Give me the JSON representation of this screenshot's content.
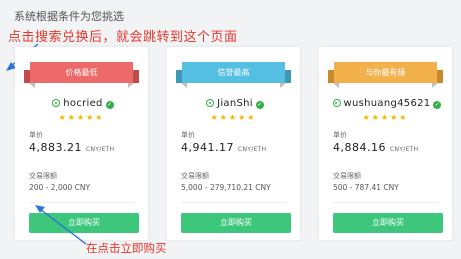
{
  "page_title": "系统根据条件为您挑选",
  "annotations": {
    "top": "点击搜索兑换后，就会跳转到这个页面",
    "bottom": "在点击立即购买"
  },
  "labels": {
    "price": "单价",
    "limit": "交易限额"
  },
  "cards": [
    {
      "ribbon": "价格最低",
      "ribbon_color": "#ee6a6a",
      "username": "hocried",
      "stars": "★★★★★",
      "price": "4,883.21",
      "unit": "CNY/ETH",
      "limit": "200 - 2,000 CNY",
      "buy": "立即购买"
    },
    {
      "ribbon": "信誉最高",
      "ribbon_color": "#54bfe0",
      "username": "JianShi",
      "stars": "★★★★★",
      "price": "4,941.17",
      "unit": "CNY/ETH",
      "limit": "5,000 - 279,710.21 CNY",
      "buy": "立即购买"
    },
    {
      "ribbon": "与你最有缘",
      "ribbon_color": "#f2b14b",
      "username": "wushuang45621",
      "stars": "★★★★★",
      "price": "4,884.16",
      "unit": "CNY/ETH",
      "limit": "500 - 787.41 CNY",
      "buy": "立即购买"
    }
  ],
  "colors": {
    "accent_green": "#3dc77c",
    "annotation_red": "#e8362a",
    "star": "#f5b400"
  }
}
